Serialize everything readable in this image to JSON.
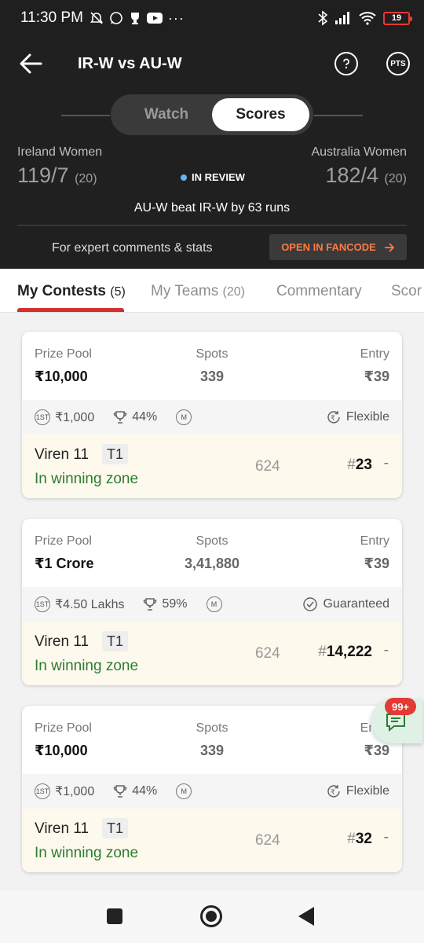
{
  "status_bar": {
    "time": "11:30 PM",
    "dots": "···",
    "battery": "19"
  },
  "header": {
    "title": "IR-W vs AU-W",
    "pts_label": "PTS",
    "toggle": {
      "watch": "Watch",
      "scores": "Scores"
    },
    "team_left": {
      "name": "Ireland Women",
      "score": "119/7",
      "overs": "(20)"
    },
    "team_right": {
      "name": "Australia Women",
      "score": "182/4",
      "overs": "(20)"
    },
    "status": "IN REVIEW",
    "result": "AU-W beat IR-W by 63 runs",
    "expert_text": "For expert comments & stats",
    "fancode_button": "OPEN IN FANCODE"
  },
  "tabs": [
    {
      "label": "My Contests",
      "count": "(5)"
    },
    {
      "label": "My Teams",
      "count": "(20)"
    },
    {
      "label": "Commentary",
      "count": ""
    },
    {
      "label": "Scor",
      "count": ""
    }
  ],
  "labels": {
    "prize_pool": "Prize Pool",
    "spots": "Spots",
    "entry": "Entry",
    "first_icon": "1ST",
    "mega_icon": "M"
  },
  "contests": [
    {
      "prize": "₹10,000",
      "spots": "339",
      "entry": "₹39",
      "first_prize": "₹1,000",
      "win_pct": "44%",
      "type": "Flexible",
      "team": "Viren 11",
      "team_tag": "T1",
      "zone": "In winning zone",
      "points": "624",
      "rank": "23"
    },
    {
      "prize": "₹1 Crore",
      "spots": "3,41,880",
      "entry": "₹39",
      "first_prize": "₹4.50 Lakhs",
      "win_pct": "59%",
      "type": "Guaranteed",
      "team": "Viren 11",
      "team_tag": "T1",
      "zone": "In winning zone",
      "points": "624",
      "rank": "14,222"
    },
    {
      "prize": "₹10,000",
      "spots": "339",
      "entry": "₹39",
      "first_prize": "₹1,000",
      "win_pct": "44%",
      "type": "Flexible",
      "team": "Viren 11",
      "team_tag": "T1",
      "zone": "In winning zone",
      "points": "624",
      "rank": "32"
    }
  ],
  "chat_badge": "99+",
  "rank_prefix": "#",
  "dash": "-"
}
